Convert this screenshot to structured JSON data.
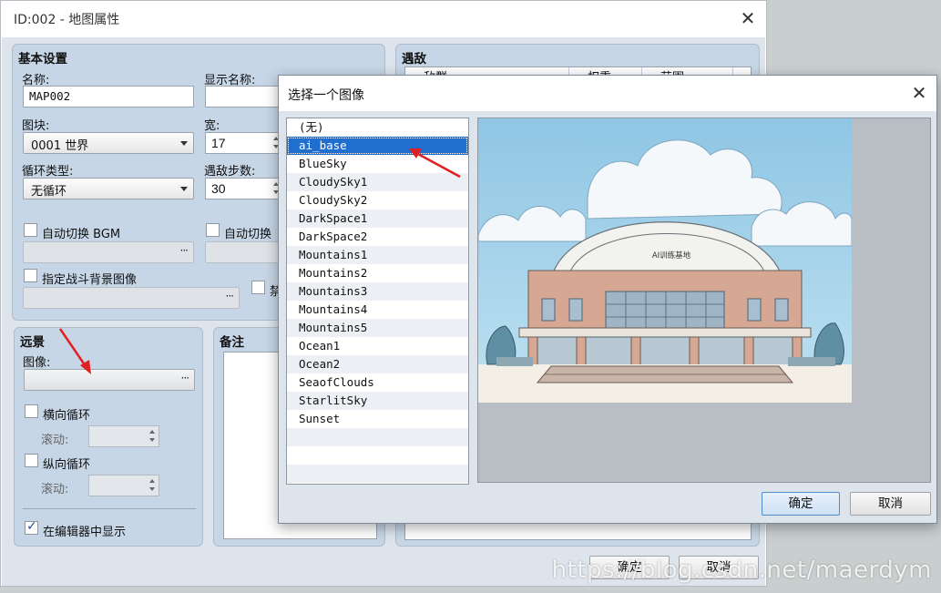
{
  "main_window": {
    "title": "ID:002 - 地图属性",
    "basic_settings": {
      "title": "基本设置",
      "name_label": "名称:",
      "name_value": "MAP002",
      "display_name_label": "显示名称:",
      "display_name_value": "",
      "tileset_label": "图块:",
      "tileset_value": "0001 世界",
      "width_label": "宽:",
      "width_value": "17",
      "scroll_type_label": "循环类型:",
      "scroll_type_value": "无循环",
      "encounter_steps_label": "遇敌步数:",
      "encounter_steps_value": "30",
      "auto_bgm_label": "自动切换 BGM",
      "auto_bgs_label": "自动切换",
      "battleback_label": "指定战斗背景图像",
      "disable_label": "禁"
    },
    "encounters": {
      "title": "遇敌",
      "columns": [
        "敌群",
        "权重",
        "范围"
      ]
    },
    "parallax": {
      "title": "远景",
      "image_label": "图像:",
      "loop_h_label": "横向循环",
      "scroll_label_1": "滚动:",
      "loop_v_label": "纵向循环",
      "scroll_label_2": "滚动:",
      "show_in_editor_label": "在编辑器中显示",
      "show_in_editor_checked": true
    },
    "notes": {
      "title": "备注"
    },
    "ok_label": "确定",
    "cancel_label": "取消"
  },
  "image_dialog": {
    "title": "选择一个图像",
    "items": [
      "(无)",
      "ai_base",
      "BlueSky",
      "CloudySky1",
      "CloudySky2",
      "DarkSpace1",
      "DarkSpace2",
      "Mountains1",
      "Mountains2",
      "Mountains3",
      "Mountains4",
      "Mountains5",
      "Ocean1",
      "Ocean2",
      "SeaofClouds",
      "StarlitSky",
      "Sunset"
    ],
    "selected_index": 1,
    "preview_sign_text": "AI训练基地",
    "ok_label": "确定",
    "cancel_label": "取消"
  },
  "watermark": "https://blog.csdn.net/maerdym",
  "colors": {
    "panel": "#c7d6e6",
    "selection": "#1f6fd1",
    "annotation_arrow": "#e02020"
  }
}
